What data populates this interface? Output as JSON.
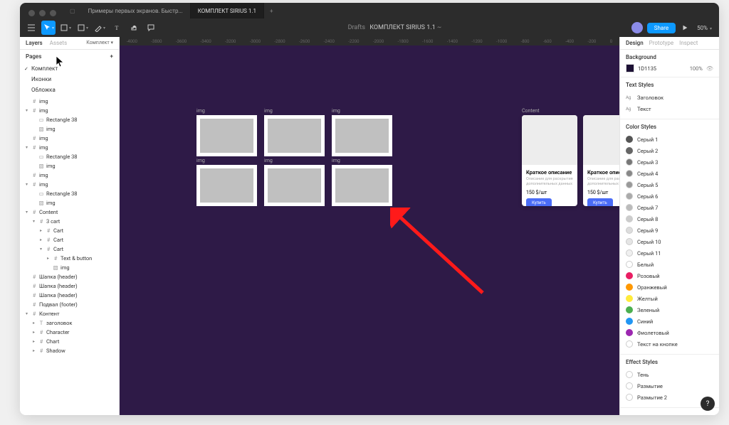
{
  "tabs": {
    "list": [
      {
        "label": "Примеры первых экранов. Быстр..."
      },
      {
        "label": "КОМПЛЕКТ SIRIUS 1.1"
      }
    ]
  },
  "toolbar": {
    "drafts": "Drafts",
    "title": "КОМПЛЕКТ SIRIUS 1.1",
    "star": "~",
    "share": "Share",
    "zoom": "50%"
  },
  "left_panel": {
    "tabs": {
      "layers": "Layers",
      "assets": "Assets",
      "page_selector": "Комплект"
    },
    "pages_header": "Pages",
    "pages": [
      {
        "label": "Комплект",
        "selected": true
      },
      {
        "label": "Иконки",
        "selected": false
      },
      {
        "label": "Обложка",
        "selected": false
      }
    ],
    "layers": [
      {
        "label": "img",
        "icon": "frame",
        "indent": 0,
        "toggle": " "
      },
      {
        "label": "img",
        "icon": "frame",
        "indent": 0,
        "toggle": "▾"
      },
      {
        "label": "Rectangle 38",
        "icon": "rect",
        "indent": 1
      },
      {
        "label": "img",
        "icon": "img",
        "indent": 1
      },
      {
        "label": "img",
        "icon": "frame",
        "indent": 0,
        "toggle": " "
      },
      {
        "label": "img",
        "icon": "frame",
        "indent": 0,
        "toggle": "▾"
      },
      {
        "label": "Rectangle 38",
        "icon": "rect",
        "indent": 1
      },
      {
        "label": "img",
        "icon": "img",
        "indent": 1
      },
      {
        "label": "img",
        "icon": "frame",
        "indent": 0,
        "toggle": " "
      },
      {
        "label": "img",
        "icon": "frame",
        "indent": 0,
        "toggle": "▾"
      },
      {
        "label": "Rectangle 38",
        "icon": "rect",
        "indent": 1
      },
      {
        "label": "img",
        "icon": "img",
        "indent": 1
      },
      {
        "label": "Content",
        "icon": "frame",
        "indent": 0,
        "toggle": "▾"
      },
      {
        "label": "3 cart",
        "icon": "frame",
        "indent": 1,
        "toggle": "▾"
      },
      {
        "label": "Cart",
        "icon": "frame",
        "indent": 2,
        "toggle": "▸"
      },
      {
        "label": "Cart",
        "icon": "frame",
        "indent": 2,
        "toggle": "▸"
      },
      {
        "label": "Cart",
        "icon": "frame",
        "indent": 2,
        "toggle": "▾"
      },
      {
        "label": "Text & button",
        "icon": "frame",
        "indent": 3,
        "toggle": "▸"
      },
      {
        "label": "img",
        "icon": "img",
        "indent": 3
      },
      {
        "label": "Шапка (header)",
        "icon": "frame",
        "indent": 0,
        "toggle": " "
      },
      {
        "label": "Шапка (header)",
        "icon": "frame",
        "indent": 0,
        "toggle": " "
      },
      {
        "label": "Шапка (header)",
        "icon": "frame",
        "indent": 0,
        "toggle": " "
      },
      {
        "label": "Подвал (footer)",
        "icon": "frame",
        "indent": 0,
        "toggle": " "
      },
      {
        "label": "Контент",
        "icon": "frame",
        "indent": 0,
        "toggle": "▾"
      },
      {
        "label": "заголовок",
        "icon": "text",
        "indent": 1,
        "toggle": "▸"
      },
      {
        "label": "Character",
        "icon": "frame",
        "indent": 1,
        "toggle": "▸"
      },
      {
        "label": "Chart",
        "icon": "frame",
        "indent": 1,
        "toggle": "▸"
      },
      {
        "label": "Shadow",
        "icon": "frame",
        "indent": 1,
        "toggle": "▸"
      }
    ]
  },
  "canvas": {
    "ruler_marks": [
      "-4000",
      "-3800",
      "-3600",
      "-3400",
      "-3200",
      "-3000",
      "-2800",
      "-2600",
      "-2400",
      "-2200",
      "-2000",
      "-1800",
      "-1600",
      "-1400",
      "-1200",
      "-1000",
      "-800",
      "-600",
      "-400",
      "-200",
      "0"
    ],
    "img_labels": [
      "img",
      "img",
      "img",
      "img",
      "img",
      "img"
    ],
    "content_label": "Content",
    "card": {
      "title": "Краткое описание",
      "desc": "Описание для раскрытия дополнительных данных",
      "price": "150 $/шт",
      "button": "Купить"
    }
  },
  "right_panel": {
    "tabs": {
      "design": "Design",
      "prototype": "Prototype",
      "inspect": "Inspect"
    },
    "background": {
      "title": "Background",
      "hex": "1D1135",
      "opacity": "100%"
    },
    "text_styles": {
      "title": "Text Styles",
      "items": [
        "Заголовок",
        "Текст"
      ]
    },
    "color_styles": {
      "title": "Color Styles",
      "items": [
        {
          "label": "Серый 1",
          "color": "#555"
        },
        {
          "label": "Серый 2",
          "color": "#666"
        },
        {
          "label": "Серый 3",
          "color": "#777",
          "outline": true
        },
        {
          "label": "Серый 4",
          "color": "#888",
          "outline": true
        },
        {
          "label": "Серый 5",
          "color": "#999",
          "outline": true
        },
        {
          "label": "Серый 6",
          "color": "#aaa",
          "outline": true
        },
        {
          "label": "Серый 7",
          "color": "#bbb",
          "outline": true
        },
        {
          "label": "Серый 8",
          "color": "#ccc",
          "outline": true
        },
        {
          "label": "Серый 9",
          "color": "#ddd",
          "outline": true
        },
        {
          "label": "Серый 10",
          "color": "#e5e5e5",
          "outline": true
        },
        {
          "label": "Серый 11",
          "color": "#f0f0f0",
          "outline": true
        },
        {
          "label": "Белый",
          "color": "#fff",
          "outline": true
        },
        {
          "label": "Розовый",
          "color": "#e91e63"
        },
        {
          "label": "Оранжевый",
          "color": "#ff9800"
        },
        {
          "label": "Желтый",
          "color": "#ffeb3b"
        },
        {
          "label": "Зеленый",
          "color": "#4caf50"
        },
        {
          "label": "Синий",
          "color": "#2196f3"
        },
        {
          "label": "Фиолетовый",
          "color": "#9c27b0"
        },
        {
          "label": "Текст на кнопке",
          "color": "#fff",
          "outline": true
        }
      ]
    },
    "effect_styles": {
      "title": "Effect Styles",
      "items": [
        "Тень",
        "Размытие",
        "Размытие 2"
      ]
    }
  }
}
